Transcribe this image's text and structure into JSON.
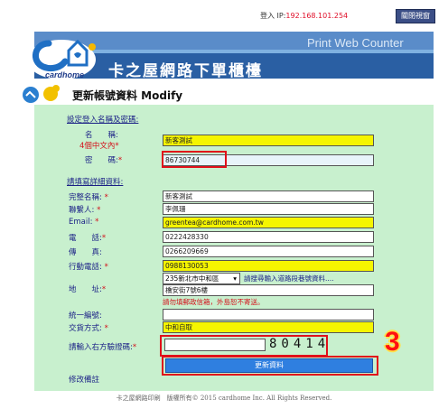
{
  "header": {
    "ip_label": "登入 IP:",
    "ip_value": "192.168.101.254",
    "close_label": "關閉視窗",
    "print_counter": "Print Web Counter",
    "site_title": "卡之屋網路下單櫃檯",
    "logo_text": "cardhome"
  },
  "page": {
    "title": "更新帳號資料 Modify"
  },
  "login_section": {
    "heading": "設定登入名稱及密碼:",
    "name_label": "名　　稱:",
    "name_hint": "4個中文內",
    "name_value": "新客測試",
    "password_label": "密　　碼:",
    "password_value": "86730744"
  },
  "detail_section": {
    "heading": "請填寫詳細資料:",
    "fullname_label": "完整名稱:",
    "fullname_value": "新客測試",
    "contact_label": "聯繫人:",
    "contact_value": "李佩珊",
    "email_label": "Email:",
    "email_value": "greentea@cardhome.com.tw",
    "phone_label": "電　　話:",
    "phone_value": "0222428330",
    "fax_label": "傳　　真:",
    "fax_value": "0266209669",
    "mobile_label": "行動電話:",
    "mobile_value": "0988130053",
    "address_label": "地　　址:",
    "district_value": "235新北市中和區",
    "address_link": "請搜尋輸入道路段巷號資料....",
    "address_value": "橋安街7號6樓",
    "address_warning": "請勿填郵政信箱，外島恕不寄送。",
    "taxid_label": "統一編號:",
    "taxid_value": "",
    "delivery_label": "交貨方式:",
    "delivery_value": "中和自取",
    "captcha_label": "請輸入右方驗證碼:",
    "captcha_input": "",
    "captcha_code": "80414",
    "submit_label": "更新資料",
    "remark_label": "修改備註"
  },
  "badge": "3",
  "required_mark": "*",
  "footer": "卡之屋網路印刷　版權所有© 2015 cardhome Inc. All Rights Reserved.",
  "colors": {
    "panel_bg": "#c8f0ce",
    "banner": "#2a5fa3",
    "required": "#d4101a",
    "label": "#1a1f86",
    "highlight": "#f5f500",
    "submit": "#2f7fe0"
  }
}
